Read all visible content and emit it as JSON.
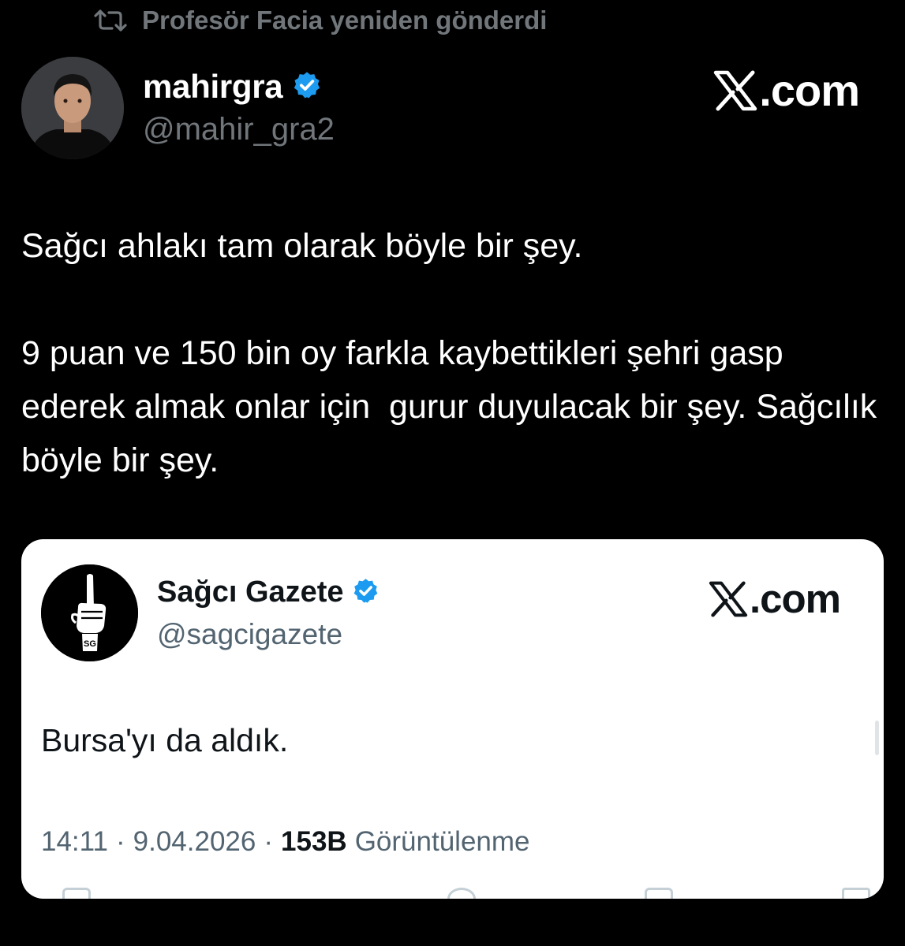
{
  "repost": {
    "icon": "repost-icon",
    "text": "Profesör Facia yeniden gönderdi"
  },
  "author": {
    "name": "mahirgra",
    "handle": "@mahir_gra2",
    "verified_icon": "verified-badge-icon",
    "avatar_icon": "profile-photo"
  },
  "brand": {
    "label": ".com",
    "icon": "x-logo-icon"
  },
  "tweet": {
    "paragraph_1": "Sağcı ahlakı tam olarak böyle bir şey.",
    "paragraph_2": "9 puan ve 150 bin oy farkla kaybettikleri şehri gasp ederek almak onlar için  gurur duyulacak bir şey. Sağcılık böyle bir şey."
  },
  "quote": {
    "name": "Sağcı Gazete",
    "handle": "@sagcigazete",
    "verified_icon": "verified-badge-icon",
    "avatar_icon": "raised-finger-logo",
    "brand_label": ".com",
    "text": "Bursa'yı da aldık.",
    "time": "14:11",
    "separator": "·",
    "date": "9.04.2026",
    "views_count": "153B",
    "views_label": "Görüntülenme"
  },
  "colors": {
    "background": "#000000",
    "primary_text": "#ffffff",
    "secondary_text": "#71767b",
    "verified_blue": "#1d9bf0",
    "card_background": "#ffffff",
    "card_muted": "#536471"
  }
}
